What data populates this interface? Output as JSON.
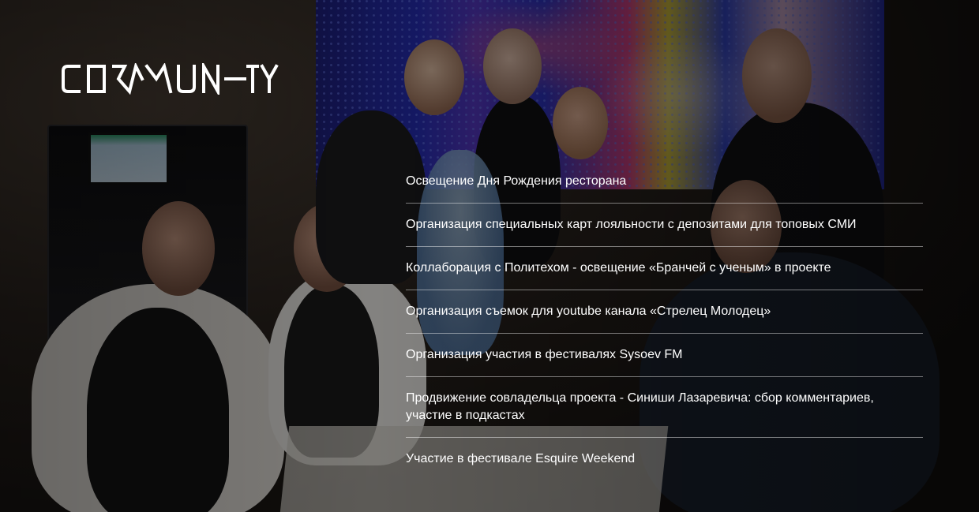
{
  "brand": {
    "logo_text": "COMMUNITY"
  },
  "items": [
    {
      "label": "Освещение Дня Рождения ресторана"
    },
    {
      "label": "Организация специальных карт лояльности с депозитами для топовых СМИ"
    },
    {
      "label": "Коллаборация с Политехом - освещение «Бранчей с ученым» в проекте"
    },
    {
      "label": "Организация съемок для youtube канала «Стрелец Молодец»"
    },
    {
      "label": "Организация участия  в фестивалях Sysoev FM"
    },
    {
      "label": "Продвижение совладельца проекта - Синиши Лазаревича: сбор комментариев, участие в подкастах"
    },
    {
      "label": "Участие в фестивале Esquire Weekend"
    }
  ],
  "colors": {
    "text": "#ffffff",
    "divider": "rgba(255,255,255,0.45)"
  }
}
